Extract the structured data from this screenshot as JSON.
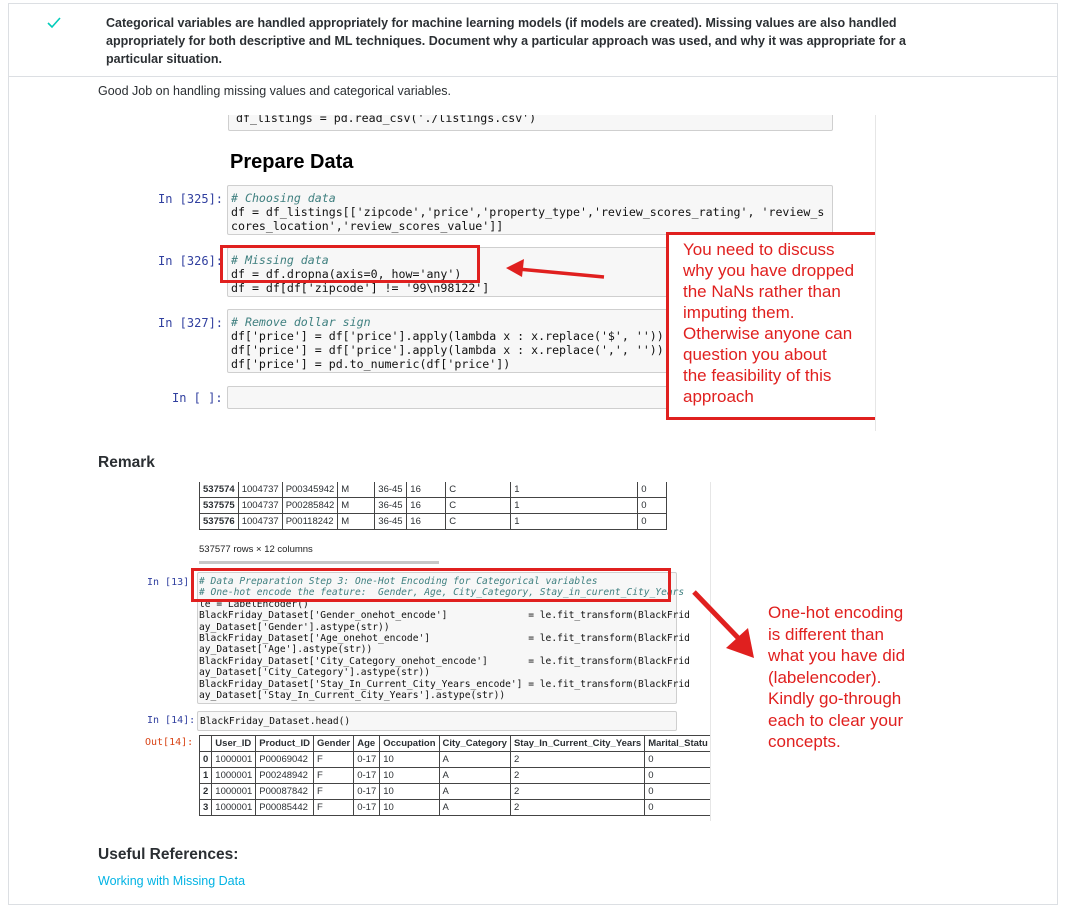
{
  "criterion": {
    "status_icon": "check-icon",
    "text": "Categorical variables are handled appropriately for machine learning models (if models are created). Missing values are also handled appropriately for both descriptive and ML techniques. Document why a particular approach was used, and why it was appropriate for a particular situation."
  },
  "review": {
    "comment": "Good Job on handling missing values and categorical variables.",
    "remark_heading": "Remark",
    "references_heading": "Useful References:",
    "reference_link": "Working with Missing Data"
  },
  "notebook1": {
    "top_code": "df_listings = pd.read_csv('./listings.csv')",
    "heading": "Prepare Data",
    "cells": [
      {
        "prompt": "In [325]:",
        "lines": [
          "# Choosing data",
          "df = df_listings[['zipcode','price','property_type','review_scores_rating', 'review_s",
          "cores_location','review_scores_value']]"
        ]
      },
      {
        "prompt": "In [326]:",
        "lines": [
          "# Missing data",
          "df = df.dropna(axis=0, how='any')",
          "df = df[df['zipcode'] != '99\\n98122']"
        ]
      },
      {
        "prompt": "In [327]:",
        "lines": [
          "# Remove dollar sign",
          "df['price'] = df['price'].apply(lambda x : x.replace('$', ''))",
          "df['price'] = df['price'].apply(lambda x : x.replace(',', ''))",
          "df['price'] = pd.to_numeric(df['price'])"
        ]
      },
      {
        "prompt": "In [ ]:",
        "lines": []
      }
    ],
    "annotation": "You need to discuss\nwhy you have dropped\nthe NaNs rather than\nimputing them.\nOtherwise anyone can\nquestion you about\nthe feasibility of this\napproach"
  },
  "notebook2": {
    "top_rows": [
      [
        "537574",
        "1004737",
        "P00345942",
        "M",
        "36-45",
        "16",
        "C",
        "1",
        "0"
      ],
      [
        "537575",
        "1004737",
        "P00285842",
        "M",
        "36-45",
        "16",
        "C",
        "1",
        "0"
      ],
      [
        "537576",
        "1004737",
        "P00118242",
        "M",
        "36-45",
        "16",
        "C",
        "1",
        "0"
      ]
    ],
    "shape_text": "537577 rows × 12 columns",
    "cell13_prompt": "In [13]:",
    "cell13_lines": [
      "# Data Preparation Step 3: One-Hot Encoding for Categorical variables",
      "# One-hot encode the feature:  Gender, Age, City_Category, Stay_in_curent_City_Years",
      "le = LabelEncoder()",
      "BlackFriday_Dataset['Gender_onehot_encode']              = le.fit_transform(BlackFrid",
      "ay_Dataset['Gender'].astype(str))",
      "BlackFriday_Dataset['Age_onehot_encode']                 = le.fit_transform(BlackFrid",
      "ay_Dataset['Age'].astype(str))",
      "BlackFriday_Dataset['City_Category_onehot_encode']       = le.fit_transform(BlackFrid",
      "ay_Dataset['City_Category'].astype(str))",
      "BlackFriday_Dataset['Stay_In_Current_City_Years_encode'] = le.fit_transform(BlackFrid",
      "ay_Dataset['Stay_In_Current_City_Years'].astype(str))"
    ],
    "cell14_prompt": "In [14]:",
    "cell14_code": "BlackFriday_Dataset.head()",
    "out14_prompt": "Out[14]:",
    "head_columns": [
      "",
      "User_ID",
      "Product_ID",
      "Gender",
      "Age",
      "Occupation",
      "City_Category",
      "Stay_In_Current_City_Years",
      "Marital_Statu"
    ],
    "head_rows": [
      [
        "0",
        "1000001",
        "P00069042",
        "F",
        "0-17",
        "10",
        "A",
        "2",
        "0"
      ],
      [
        "1",
        "1000001",
        "P00248942",
        "F",
        "0-17",
        "10",
        "A",
        "2",
        "0"
      ],
      [
        "2",
        "1000001",
        "P00087842",
        "F",
        "0-17",
        "10",
        "A",
        "2",
        "0"
      ],
      [
        "3",
        "1000001",
        "P00085442",
        "F",
        "0-17",
        "10",
        "A",
        "2",
        "0"
      ]
    ],
    "annotation": "One-hot encoding\nis different than\nwhat you have did\n(labelencoder).\nKindly go-through\neach to clear your\nconcepts."
  },
  "colors": {
    "accent_red": "#e0201f",
    "link": "#02b3e4",
    "check": "#02ccba"
  }
}
